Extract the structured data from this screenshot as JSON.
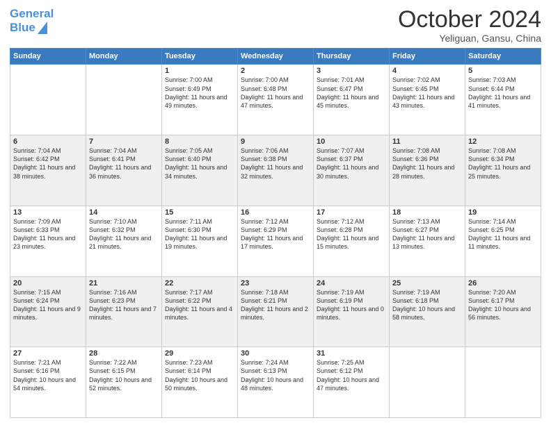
{
  "header": {
    "logo_line1": "General",
    "logo_line2": "Blue",
    "month": "October 2024",
    "location": "Yeliguan, Gansu, China"
  },
  "days_of_week": [
    "Sunday",
    "Monday",
    "Tuesday",
    "Wednesday",
    "Thursday",
    "Friday",
    "Saturday"
  ],
  "weeks": [
    [
      {
        "num": "",
        "text": ""
      },
      {
        "num": "",
        "text": ""
      },
      {
        "num": "1",
        "text": "Sunrise: 7:00 AM\nSunset: 6:49 PM\nDaylight: 11 hours and 49 minutes."
      },
      {
        "num": "2",
        "text": "Sunrise: 7:00 AM\nSunset: 6:48 PM\nDaylight: 11 hours and 47 minutes."
      },
      {
        "num": "3",
        "text": "Sunrise: 7:01 AM\nSunset: 6:47 PM\nDaylight: 11 hours and 45 minutes."
      },
      {
        "num": "4",
        "text": "Sunrise: 7:02 AM\nSunset: 6:45 PM\nDaylight: 11 hours and 43 minutes."
      },
      {
        "num": "5",
        "text": "Sunrise: 7:03 AM\nSunset: 6:44 PM\nDaylight: 11 hours and 41 minutes."
      }
    ],
    [
      {
        "num": "6",
        "text": "Sunrise: 7:04 AM\nSunset: 6:42 PM\nDaylight: 11 hours and 38 minutes."
      },
      {
        "num": "7",
        "text": "Sunrise: 7:04 AM\nSunset: 6:41 PM\nDaylight: 11 hours and 36 minutes."
      },
      {
        "num": "8",
        "text": "Sunrise: 7:05 AM\nSunset: 6:40 PM\nDaylight: 11 hours and 34 minutes."
      },
      {
        "num": "9",
        "text": "Sunrise: 7:06 AM\nSunset: 6:38 PM\nDaylight: 11 hours and 32 minutes."
      },
      {
        "num": "10",
        "text": "Sunrise: 7:07 AM\nSunset: 6:37 PM\nDaylight: 11 hours and 30 minutes."
      },
      {
        "num": "11",
        "text": "Sunrise: 7:08 AM\nSunset: 6:36 PM\nDaylight: 11 hours and 28 minutes."
      },
      {
        "num": "12",
        "text": "Sunrise: 7:08 AM\nSunset: 6:34 PM\nDaylight: 11 hours and 25 minutes."
      }
    ],
    [
      {
        "num": "13",
        "text": "Sunrise: 7:09 AM\nSunset: 6:33 PM\nDaylight: 11 hours and 23 minutes."
      },
      {
        "num": "14",
        "text": "Sunrise: 7:10 AM\nSunset: 6:32 PM\nDaylight: 11 hours and 21 minutes."
      },
      {
        "num": "15",
        "text": "Sunrise: 7:11 AM\nSunset: 6:30 PM\nDaylight: 11 hours and 19 minutes."
      },
      {
        "num": "16",
        "text": "Sunrise: 7:12 AM\nSunset: 6:29 PM\nDaylight: 11 hours and 17 minutes."
      },
      {
        "num": "17",
        "text": "Sunrise: 7:12 AM\nSunset: 6:28 PM\nDaylight: 11 hours and 15 minutes."
      },
      {
        "num": "18",
        "text": "Sunrise: 7:13 AM\nSunset: 6:27 PM\nDaylight: 11 hours and 13 minutes."
      },
      {
        "num": "19",
        "text": "Sunrise: 7:14 AM\nSunset: 6:25 PM\nDaylight: 11 hours and 11 minutes."
      }
    ],
    [
      {
        "num": "20",
        "text": "Sunrise: 7:15 AM\nSunset: 6:24 PM\nDaylight: 11 hours and 9 minutes."
      },
      {
        "num": "21",
        "text": "Sunrise: 7:16 AM\nSunset: 6:23 PM\nDaylight: 11 hours and 7 minutes."
      },
      {
        "num": "22",
        "text": "Sunrise: 7:17 AM\nSunset: 6:22 PM\nDaylight: 11 hours and 4 minutes."
      },
      {
        "num": "23",
        "text": "Sunrise: 7:18 AM\nSunset: 6:21 PM\nDaylight: 11 hours and 2 minutes."
      },
      {
        "num": "24",
        "text": "Sunrise: 7:19 AM\nSunset: 6:19 PM\nDaylight: 11 hours and 0 minutes."
      },
      {
        "num": "25",
        "text": "Sunrise: 7:19 AM\nSunset: 6:18 PM\nDaylight: 10 hours and 58 minutes."
      },
      {
        "num": "26",
        "text": "Sunrise: 7:20 AM\nSunset: 6:17 PM\nDaylight: 10 hours and 56 minutes."
      }
    ],
    [
      {
        "num": "27",
        "text": "Sunrise: 7:21 AM\nSunset: 6:16 PM\nDaylight: 10 hours and 54 minutes."
      },
      {
        "num": "28",
        "text": "Sunrise: 7:22 AM\nSunset: 6:15 PM\nDaylight: 10 hours and 52 minutes."
      },
      {
        "num": "29",
        "text": "Sunrise: 7:23 AM\nSunset: 6:14 PM\nDaylight: 10 hours and 50 minutes."
      },
      {
        "num": "30",
        "text": "Sunrise: 7:24 AM\nSunset: 6:13 PM\nDaylight: 10 hours and 48 minutes."
      },
      {
        "num": "31",
        "text": "Sunrise: 7:25 AM\nSunset: 6:12 PM\nDaylight: 10 hours and 47 minutes."
      },
      {
        "num": "",
        "text": ""
      },
      {
        "num": "",
        "text": ""
      }
    ]
  ]
}
